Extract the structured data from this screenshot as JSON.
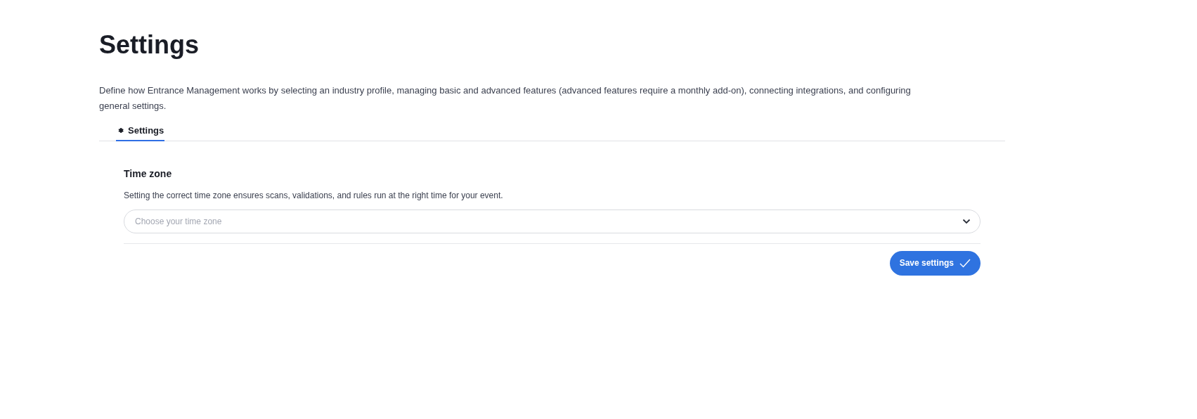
{
  "page": {
    "title": "Settings",
    "description": "Define how Entrance Management works by selecting an industry profile, managing basic and advanced features (advanced features require a monthly add-on), connecting integrations, and configuring general settings."
  },
  "tabs": [
    {
      "label": "Settings",
      "selected": true
    }
  ],
  "time_zone": {
    "heading": "Time zone",
    "help": "Setting the correct time zone ensures scans, validations, and rules run at the right time for your event.",
    "placeholder": "Choose your time zone"
  },
  "save_button": {
    "label": "Save settings"
  }
}
